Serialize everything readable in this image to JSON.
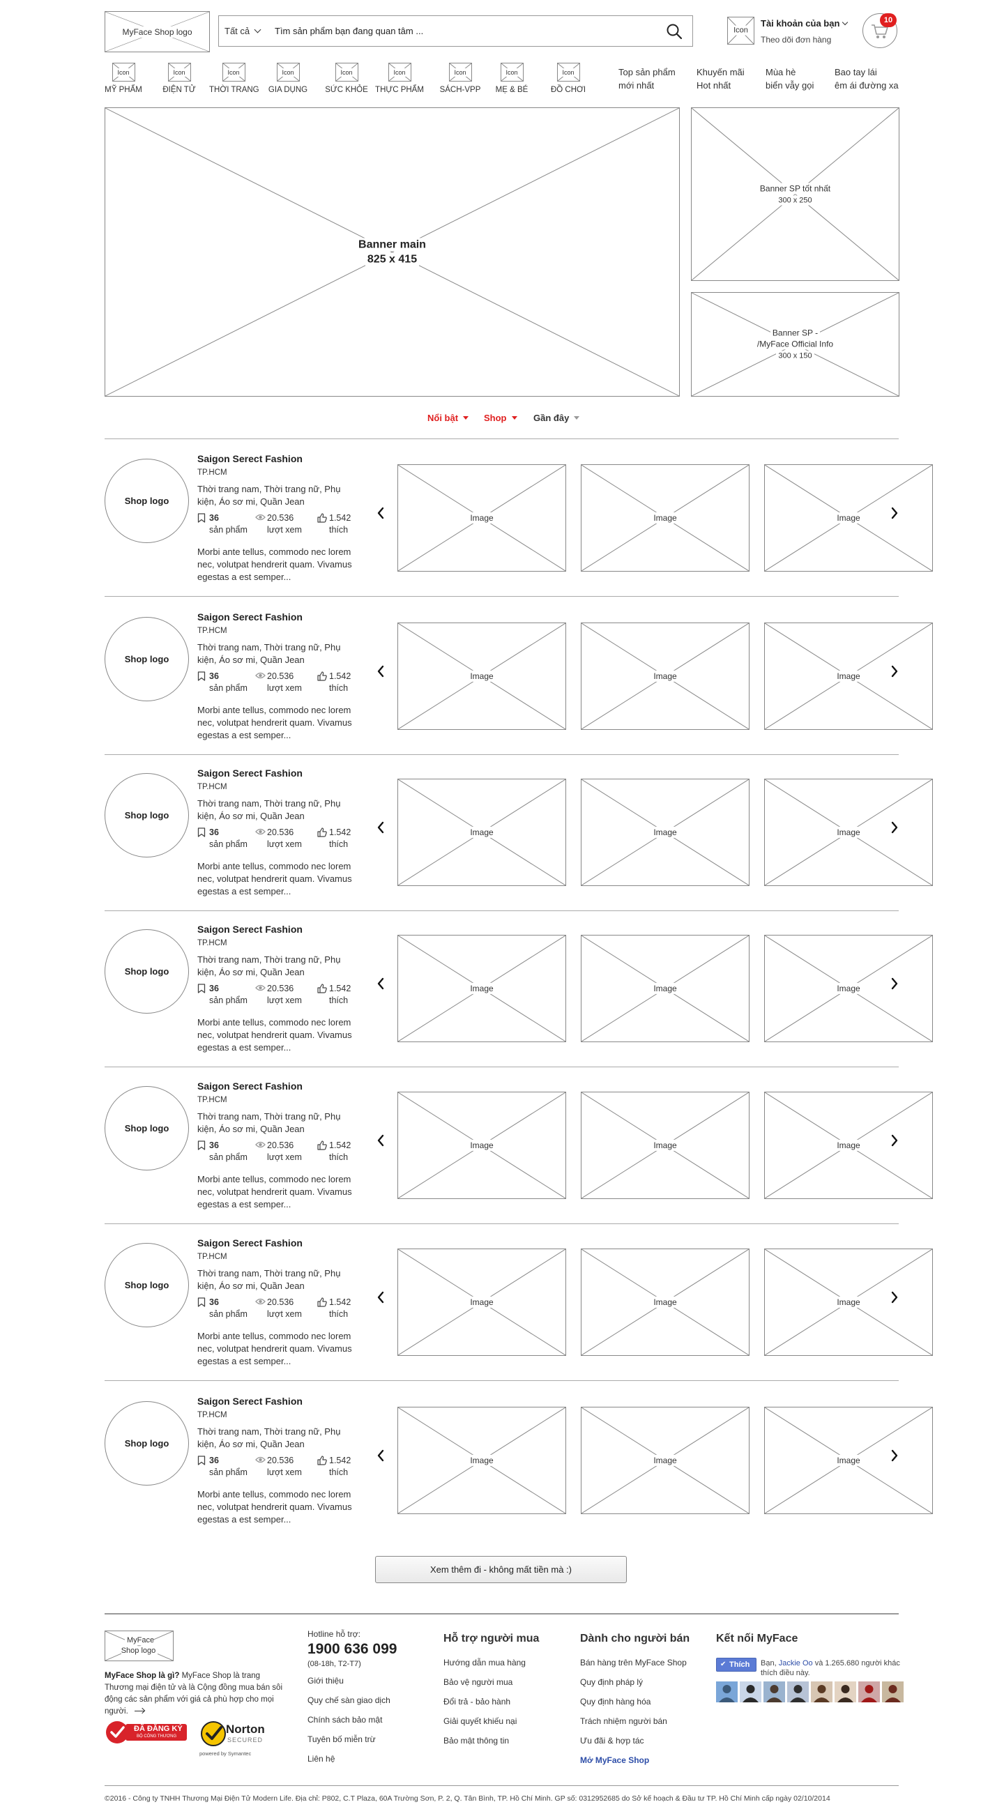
{
  "header": {
    "logo_text": "MyFace Shop logo",
    "search": {
      "category": "Tất cả",
      "placeholder": "Tìm sản phẩm bạn đang quan tâm ..."
    },
    "account": {
      "icon_label": "Icon",
      "title": "Tài khoản của bạn",
      "subtitle": "Theo dõi đơn hàng"
    },
    "cart_count": "10"
  },
  "categories": [
    {
      "icon": "Icon",
      "label": "MỸ PHẨM"
    },
    {
      "icon": "Icon",
      "label": "ĐIỆN TỬ"
    },
    {
      "icon": "Icon",
      "label": "THỜI TRANG"
    },
    {
      "icon": "Icon",
      "label": "GIA DỤNG"
    },
    {
      "icon": "Icon",
      "label": "SỨC KHỎE"
    },
    {
      "icon": "Icon",
      "label": "THỰC PHẨM"
    },
    {
      "icon": "Icon",
      "label": "SÁCH-VPP"
    },
    {
      "icon": "Icon",
      "label": "MẸ & BÉ"
    },
    {
      "icon": "Icon",
      "label": "ĐỒ CHƠI"
    }
  ],
  "promos": [
    {
      "line1": "Top sản phẩm",
      "line2": "mới nhất"
    },
    {
      "line1": "Khuyến mãi",
      "line2": "Hot nhất"
    },
    {
      "line1": "Mùa hè",
      "line2": "biển vẫy gọi"
    },
    {
      "line1": "Bao tay lái",
      "line2": "êm ái đường xa"
    }
  ],
  "banners": {
    "main": {
      "title": "Banner main",
      "size": "825 x 415"
    },
    "side1": {
      "title": "Banner SP tốt nhất",
      "size": "300 x 250"
    },
    "side2": {
      "line1": "Banner SP -",
      "line2": "/MyFace Official Info",
      "size": "300 x 150"
    }
  },
  "filter_tabs": [
    "Nổi bật",
    "Shop",
    "Gần đây"
  ],
  "shops": [
    {
      "logo": "Shop logo",
      "name": "Saigon Serect Fashion",
      "city": "TP.HCM",
      "categories": "Thời trang nam, Thời trang nữ, Phụ kiện, Áo sơ mi, Quần Jean",
      "products": "36",
      "products_label": "sản phẩm",
      "views": "20.536",
      "views_label": "lượt xem",
      "likes": "1.542",
      "likes_label": "thích",
      "description": "Morbi ante tellus, commodo nec lorem nec, volutpat hendrerit quam. Vivamus egestas a est semper...",
      "images": [
        "Image",
        "Image",
        "Image"
      ]
    },
    {
      "logo": "Shop logo",
      "name": "Saigon Serect Fashion",
      "city": "TP.HCM",
      "categories": "Thời trang nam, Thời trang nữ, Phụ kiện, Áo sơ mi, Quần Jean",
      "products": "36",
      "products_label": "sản phẩm",
      "views": "20.536",
      "views_label": "lượt xem",
      "likes": "1.542",
      "likes_label": "thích",
      "description": "Morbi ante tellus, commodo nec lorem nec, volutpat hendrerit quam. Vivamus egestas a est semper...",
      "images": [
        "Image",
        "Image",
        "Image"
      ]
    },
    {
      "logo": "Shop logo",
      "name": "Saigon Serect Fashion",
      "city": "TP.HCM",
      "categories": "Thời trang nam, Thời trang nữ, Phụ kiện, Áo sơ mi, Quần Jean",
      "products": "36",
      "products_label": "sản phẩm",
      "views": "20.536",
      "views_label": "lượt xem",
      "likes": "1.542",
      "likes_label": "thích",
      "description": "Morbi ante tellus, commodo nec lorem nec, volutpat hendrerit quam. Vivamus egestas a est semper...",
      "images": [
        "Image",
        "Image",
        "Image"
      ]
    },
    {
      "logo": "Shop logo",
      "name": "Saigon Serect Fashion",
      "city": "TP.HCM",
      "categories": "Thời trang nam, Thời trang nữ, Phụ kiện, Áo sơ mi, Quần Jean",
      "products": "36",
      "products_label": "sản phẩm",
      "views": "20.536",
      "views_label": "lượt xem",
      "likes": "1.542",
      "likes_label": "thích",
      "description": "Morbi ante tellus, commodo nec lorem nec, volutpat hendrerit quam. Vivamus egestas a est semper...",
      "images": [
        "Image",
        "Image",
        "Image"
      ]
    },
    {
      "logo": "Shop logo",
      "name": "Saigon Serect Fashion",
      "city": "TP.HCM",
      "categories": "Thời trang nam, Thời trang nữ, Phụ kiện, Áo sơ mi, Quần Jean",
      "products": "36",
      "products_label": "sản phẩm",
      "views": "20.536",
      "views_label": "lượt xem",
      "likes": "1.542",
      "likes_label": "thích",
      "description": "Morbi ante tellus, commodo nec lorem nec, volutpat hendrerit quam. Vivamus egestas a est semper...",
      "images": [
        "Image",
        "Image",
        "Image"
      ]
    },
    {
      "logo": "Shop logo",
      "name": "Saigon Serect Fashion",
      "city": "TP.HCM",
      "categories": "Thời trang nam, Thời trang nữ, Phụ kiện, Áo sơ mi, Quần Jean",
      "products": "36",
      "products_label": "sản phẩm",
      "views": "20.536",
      "views_label": "lượt xem",
      "likes": "1.542",
      "likes_label": "thích",
      "description": "Morbi ante tellus, commodo nec lorem nec, volutpat hendrerit quam. Vivamus egestas a est semper...",
      "images": [
        "Image",
        "Image",
        "Image"
      ]
    },
    {
      "logo": "Shop logo",
      "name": "Saigon Serect Fashion",
      "city": "TP.HCM",
      "categories": "Thời trang nam, Thời trang nữ, Phụ kiện, Áo sơ mi, Quần Jean",
      "products": "36",
      "products_label": "sản phẩm",
      "views": "20.536",
      "views_label": "lượt xem",
      "likes": "1.542",
      "likes_label": "thích",
      "description": "Morbi ante tellus, commodo nec lorem nec, volutpat hendrerit quam. Vivamus egestas a est semper...",
      "images": [
        "Image",
        "Image",
        "Image"
      ]
    }
  ],
  "load_more": "Xem thêm đi - không mất tiền mà :)",
  "footer": {
    "logo_text": "MyFace Shop logo",
    "about_title": "MyFace Shop là gì?",
    "about_text": "MyFace Shop là trang Thương mại điện tử và là Cộng đồng mua bán sôi động các sản phẩm với giá cả phù hợp cho mọi người.",
    "badge_registered": {
      "line1": "ĐÃ ĐĂNG KÝ",
      "line2": "BỘ CÔNG THƯƠNG"
    },
    "badge_norton": {
      "brand": "Norton",
      "secured": "SECURED",
      "powered": "powered by Symantec"
    },
    "hotline_label": "Hotline hỗ trợ:",
    "hotline": "1900 636 099",
    "hotline_hours": "(08-18h, T2-T7)",
    "col1_links": [
      "Giới thiệu",
      "Quy chế sàn giao dịch",
      "Chính sách bảo mật",
      "Tuyên bố miễn trừ",
      "Liên hệ"
    ],
    "col2_title": "Hỗ trợ người mua",
    "col2_links": [
      "Hướng dẫn mua hàng",
      "Bảo vệ người mua",
      "Đổi trả - bảo hành",
      "Giải quyết khiếu nại",
      "Bảo mật thông tin"
    ],
    "col3_title": "Dành cho người bán",
    "col3_links": [
      "Bán hàng trên MyFace Shop",
      "Quy định pháp lý",
      "Quy định hàng hóa",
      "Trách nhiệm người bán",
      "Ưu đãi & hợp tác",
      "Mở MyFace Shop"
    ],
    "col4_title": "Kết nối MyFace",
    "fb_like": "Thích",
    "fb_text_pre": "Bạn,",
    "fb_name": "Jackie Oo",
    "fb_text_post": "và 1.265.680 người khác thích điều này.",
    "copyright": "©2016 - Công ty TNHH Thương Mại Điện Tử Modern Life. Địa chỉ: P802, C.T Plaza, 60A Trường Sơn, P. 2, Q. Tân Bình, TP. Hồ Chí Minh. GP số: 0312952685 do Sở kế hoạch & Đầu tư TP. Hồ Chí Minh cấp ngày 02/10/2014"
  },
  "colors": {
    "accent_red": "#e02020",
    "link_blue": "#2e4ea8",
    "facebook_blue": "#5b7bd5"
  }
}
